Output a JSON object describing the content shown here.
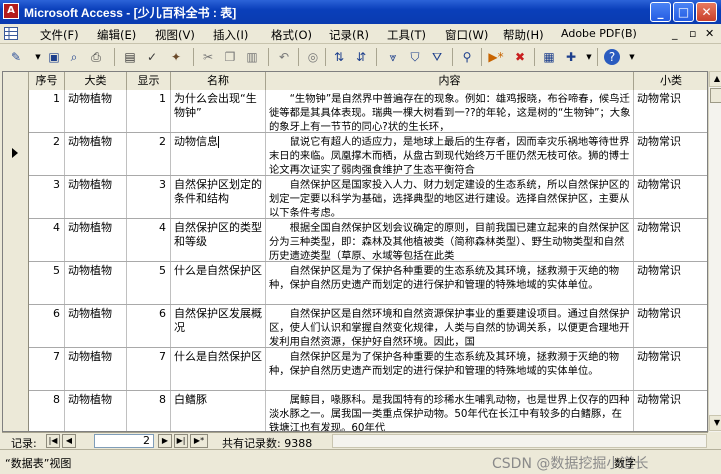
{
  "window": {
    "title": "Microsoft Access - [少儿百科全书 : 表]",
    "app_icon": "A",
    "controls": {
      "minimize": "_",
      "maximize": "□",
      "close": "✕"
    }
  },
  "menu": {
    "items": [
      "文件(F)",
      "编辑(E)",
      "视图(V)",
      "插入(I)",
      "格式(O)",
      "记录(R)",
      "工具(T)",
      "窗口(W)",
      "帮助(H)"
    ],
    "help_search": "Adobe PDF(B)",
    "mdi_controls": {
      "minimize": "_",
      "restore": "▫",
      "close": "✕"
    }
  },
  "toolbar": {
    "icons": [
      "design-view-icon",
      "save-icon",
      "search-icon",
      "print-icon",
      "print-preview-icon",
      "spelling-icon",
      "cut-icon",
      "copy-icon",
      "paste-icon",
      "undo-icon",
      "hyperlink-icon",
      "sort-ascending-icon",
      "sort-descending-icon",
      "filter-by-selection-icon",
      "filter-by-form-icon",
      "apply-filter-icon",
      "find-icon",
      "new-record-icon",
      "delete-record-icon",
      "database-window-icon",
      "new-object-icon",
      "help-icon"
    ]
  },
  "datasheet": {
    "columns": [
      "序号",
      "大类",
      "显示",
      "名称",
      "内容",
      "小类"
    ],
    "rows": [
      {
        "id": "1",
        "category": "动物植物",
        "display": "1",
        "name": "为什么会出现“生物钟”",
        "content": "“生物钟”是自然界中普遍存在的现象。例如：雄鸡报晓，布谷啼春，候鸟迁徙等都是其具体表现。瑞典一棵大树看到一??的年轮，这是树的“生物钟”；大象的象牙上有一节节的同心?状的生长环，",
        "subcategory": "动物常识"
      },
      {
        "id": "2",
        "category": "动物植物",
        "display": "2",
        "name": "动物信息",
        "content": "鼠说它有超人的适应力，是地球上最后的生存者，因而幸灾乐祸地等待世界末日的来临。凤凰撑木而栖，从盘古到现代始终万千匪仍然无枝可依。狮的博士论文再次证实了弱肉强食维护了生态平衡符合",
        "subcategory": "动物常识",
        "editing": true
      },
      {
        "id": "3",
        "category": "动物植物",
        "display": "3",
        "name": "自然保护区划定的条件和结构",
        "content": "自然保护区是国家投入人力、财力划定建设的生态系统，所以自然保护区的划定一定要以科学为基础，选择典型的地区进行建设。选择自然保护区，主要从以下条件考虑。",
        "subcategory": "动物常识"
      },
      {
        "id": "4",
        "category": "动物植物",
        "display": "4",
        "name": "自然保护区的类型和等级",
        "content": "根据全国自然保护区划会议确定的原则，目前我国已建立起来的自然保护区分为三种类型，即：森林及其他植被类（简称森林类型）、野生动物类型和自然历史遗迹类型（草原、水域等包括在此类",
        "subcategory": "动物常识"
      },
      {
        "id": "5",
        "category": "动物植物",
        "display": "5",
        "name": "什么是自然保护区",
        "content": "自然保护区是为了保护各种重要的生态系统及其环境，拯救濒于灭绝的物种，保护自然历史遗产而划定的进行保护和管理的特殊地域的实体单位。",
        "subcategory": "动物常识"
      },
      {
        "id": "6",
        "category": "动物植物",
        "display": "6",
        "name": "自然保护区发展概况",
        "content": "自然保护区是自然环境和自然资源保护事业的重要建设项目。通过自然保护区，使人们认识和掌握自然变化规律，人类与自然的协调关系，以便更合理地开发利用自然资源，保护好自然环境。因此，国",
        "subcategory": "动物常识"
      },
      {
        "id": "7",
        "category": "动物植物",
        "display": "7",
        "name": "什么是自然保护区",
        "content": "自然保护区是为了保护各种重要的生态系统及其环境，拯救濒于灭绝的物种，保护自然历史遗产而划定的进行保护和管理的特殊地域的实体单位。",
        "subcategory": "动物常识"
      },
      {
        "id": "8",
        "category": "动物植物",
        "display": "8",
        "name": "白鳍豚",
        "content": "属鲸目，喙豚科。是我国特有的珍稀水生哺乳动物，也是世界上仅存的四种淡水豚之一。属我国一类重点保护动物。50年代在长江中有较多的白鳍豚，在铁塘江也有发现。60年代",
        "subcategory": "动物常识"
      }
    ]
  },
  "navigator": {
    "label": "记录:",
    "current": "2",
    "total_label": "共有记录数: 9388",
    "buttons": {
      "first": "|◀",
      "prev": "◀",
      "next": "▶",
      "last": "▶|",
      "new": "▶*"
    }
  },
  "status": {
    "view": "“数据表”视图",
    "indicator": "数字",
    "watermark": "CSDN @数据挖掘小道长"
  }
}
